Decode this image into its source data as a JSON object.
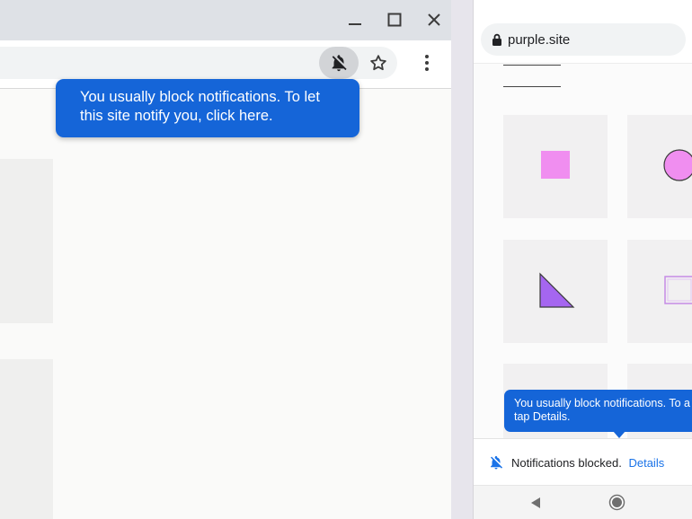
{
  "desktop": {
    "window_controls": {
      "minimize": "minimize-icon",
      "maximize": "maximize-icon",
      "close": "close-icon"
    },
    "toolbar": {
      "notifications_chip_icon": "bell-off-icon",
      "bookmark_icon": "star-icon",
      "menu_icon": "more-vert-icon"
    },
    "tooltip": {
      "text": "You usually block notifications. To let this site notify you, click here."
    }
  },
  "phone": {
    "url": "purple.site",
    "url_icon": "lock-icon",
    "cards": [
      "square",
      "circle",
      "triangle",
      "square-outline"
    ],
    "shape_colors": {
      "pink": "#f08ef0",
      "purple": "#a566f0",
      "outline": "#c58be6"
    },
    "tooltip": {
      "text": "You usually block notifications. To a tap Details."
    },
    "infobar": {
      "icon": "bell-off-icon",
      "message": "Notifications blocked.",
      "link": "Details"
    },
    "navbar": {
      "back": "back-icon",
      "home": "home-icon"
    }
  },
  "colors": {
    "accent": "#1565d8",
    "link": "#1a73e8"
  }
}
